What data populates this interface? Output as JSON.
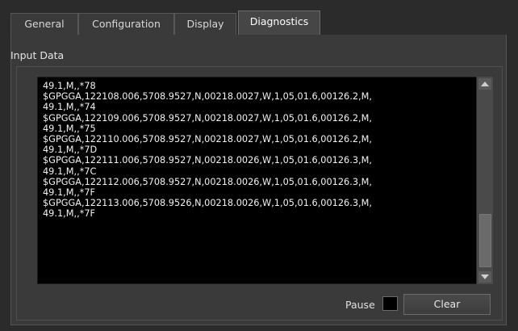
{
  "tabs": [
    {
      "label": "General",
      "active": false
    },
    {
      "label": "Configuration",
      "active": false
    },
    {
      "label": "Display",
      "active": false
    },
    {
      "label": "Diagnostics",
      "active": true
    }
  ],
  "input_data": {
    "title": "Input Data",
    "lines": [
      "49.1,M,,*78",
      "$GPGGA,122108.006,5708.9527,N,00218.0027,W,1,05,01.6,00126.2,M,",
      "49.1,M,,*74",
      "$GPGGA,122109.006,5708.9527,N,00218.0027,W,1,05,01.6,00126.2,M,",
      "49.1,M,,*75",
      "$GPGGA,122110.006,5708.9527,N,00218.0027,W,1,05,01.6,00126.2,M,",
      "49.1,M,,*7D",
      "$GPGGA,122111.006,5708.9527,N,00218.0026,W,1,05,01.6,00126.3,M,",
      "49.1,M,,*7C",
      "$GPGGA,122112.006,5708.9527,N,00218.0026,W,1,05,01.6,00126.3,M,",
      "49.1,M,,*7F",
      "$GPGGA,122113.006,5708.9526,N,00218.0026,W,1,05,01.6,00126.3,M,",
      "49.1,M,,*7F"
    ]
  },
  "controls": {
    "pause_label": "Pause",
    "pause_checked": false,
    "clear_label": "Clear"
  },
  "colors": {
    "background": "#2b2b2b",
    "panel": "#3a3a3a",
    "textarea": "#000000",
    "text": "#f2f2f2"
  }
}
